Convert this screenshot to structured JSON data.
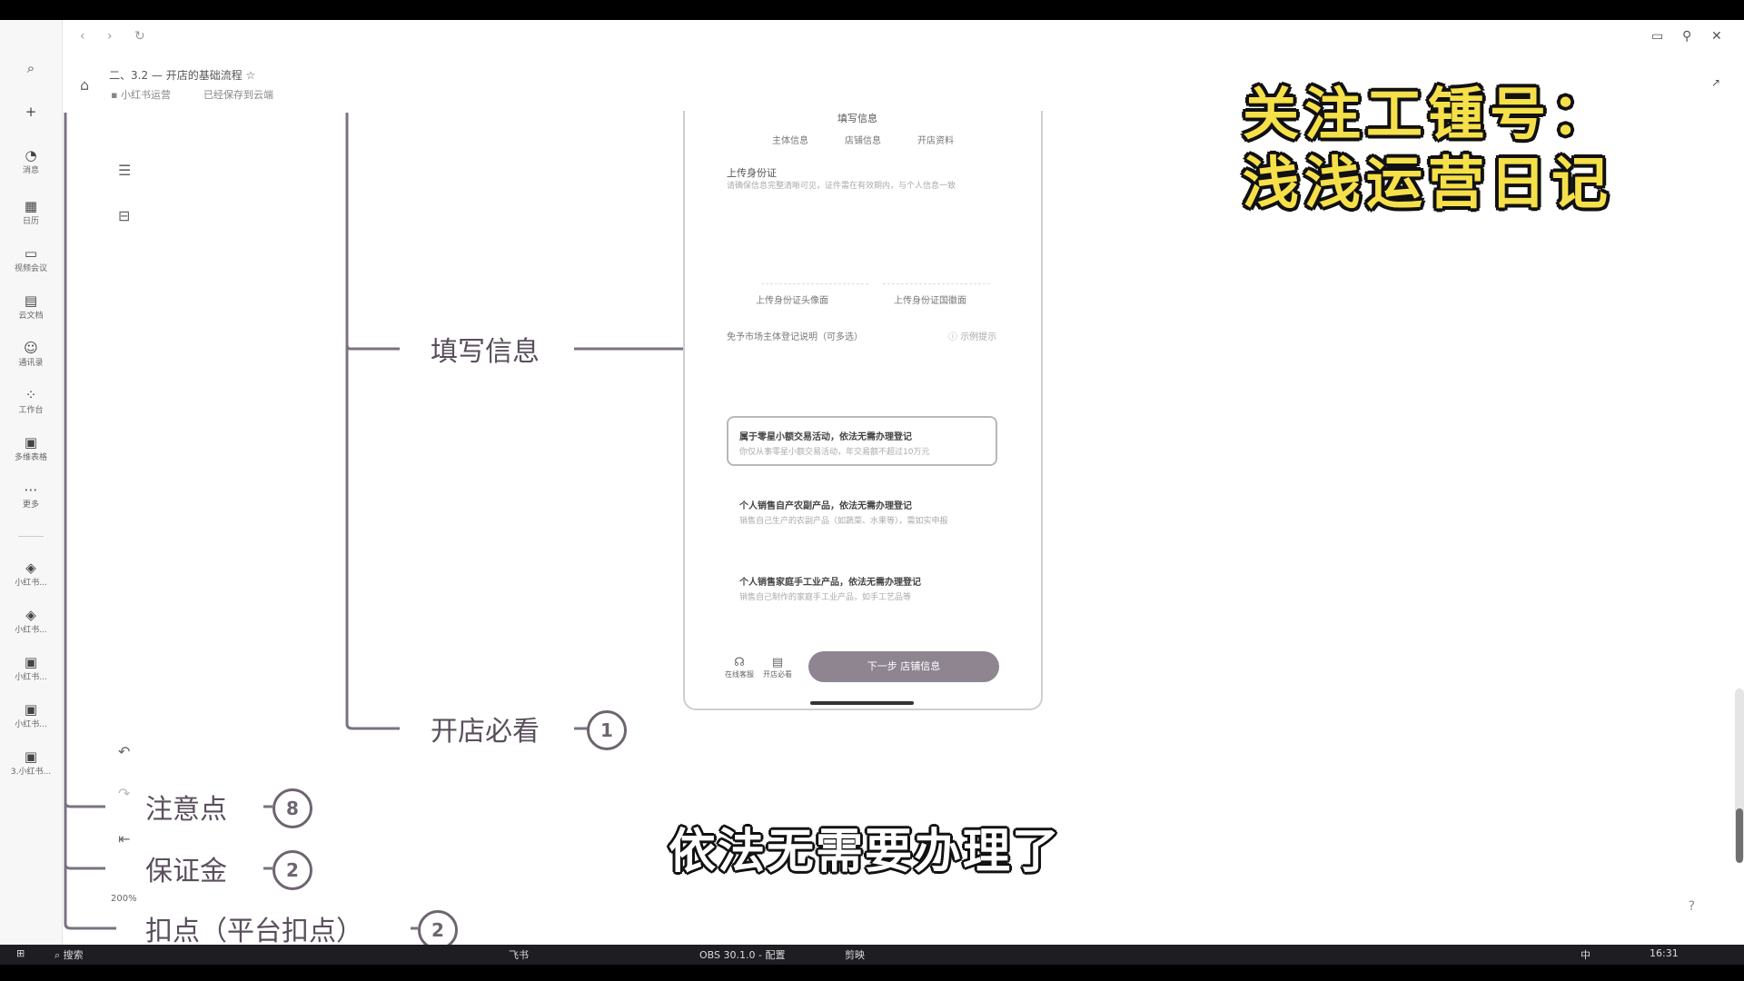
{
  "titlebar": {
    "back": "‹",
    "forward": "›",
    "refresh": "↻",
    "doc_title": "二、3.2 — 开店的基础流程",
    "star": "☆",
    "breadcrumb": "小红书运营",
    "save_status": "已经保存到云端"
  },
  "sidebar": {
    "items": [
      {
        "icon": "search-icon",
        "label": ""
      },
      {
        "icon": "plus-icon",
        "label": ""
      },
      {
        "icon": "message-icon",
        "label": "消息"
      },
      {
        "icon": "calendar-icon",
        "label": "日历"
      },
      {
        "icon": "video-icon",
        "label": "视频会议"
      },
      {
        "icon": "doc-icon",
        "label": "云文档"
      },
      {
        "icon": "contacts-icon",
        "label": "通讯录"
      },
      {
        "icon": "apps-icon",
        "label": "工作台"
      },
      {
        "icon": "book-icon",
        "label": "多维表格"
      },
      {
        "icon": "more-icon",
        "label": "更多"
      }
    ],
    "shortcuts": [
      "小红书...",
      "小红书...",
      "小红书...",
      "小红书...",
      "3.小红书..."
    ]
  },
  "mindmap": {
    "nodes": {
      "fill_info": "填写信息",
      "must_read": "开店必看",
      "notes": "注意点",
      "deposit": "保证金",
      "commission": "扣点（平台扣点）"
    },
    "badges": {
      "must_read": "1",
      "notes": "8",
      "deposit": "2",
      "commission": "2"
    },
    "zoom_level": "200%"
  },
  "phone": {
    "top_title": "填写信息",
    "steps": [
      "主体信息",
      "店铺信息",
      "开店资料"
    ],
    "section_title": "上传身份证",
    "section_note": "请确保信息完整清晰可见，证件需在有效期内，与个人信息一致",
    "upload_front": "上传身份证头像面",
    "upload_back": "上传身份证国徽面",
    "reg_label": "免予市场主体登记说明（可多选）",
    "reg_example": "示例提示",
    "options": [
      {
        "title": "属于零星小额交易活动，依法无需办理登记",
        "desc": "你仅从事零星小额交易活动，年交易额不超过10万元"
      },
      {
        "title": "个人销售自产农副产品，依法无需办理登记",
        "desc": "销售自己生产的农副产品（如蔬菜、水果等），需如实申报"
      },
      {
        "title": "个人销售家庭手工业产品，依法无需办理登记",
        "desc": "销售自己制作的家庭手工业产品，如手工艺品等"
      }
    ],
    "bottom_left_1": "在线客服",
    "bottom_left_2": "开店必看",
    "primary_button": "下一步 店铺信息"
  },
  "overlay": {
    "watermark_line1": "关注工锺号：",
    "watermark_line2": "浅浅运营日记",
    "subtitle": "依法无需要办理了"
  },
  "taskbar": {
    "search": "搜索",
    "clock": "16:31",
    "ime": "中",
    "app1": "飞书",
    "app2": "OBS 30.1.0 - 配置",
    "app3": "剪映"
  }
}
